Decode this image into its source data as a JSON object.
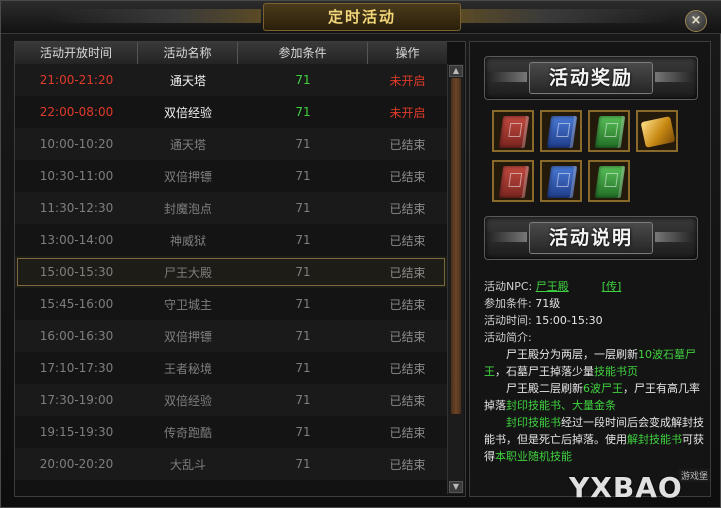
{
  "window": {
    "title": "定时活动",
    "close_glyph": "×"
  },
  "table": {
    "headers": [
      "活动开放时间",
      "活动名称",
      "参加条件",
      "操作"
    ],
    "rows": [
      {
        "time": "21:00-21:20",
        "name": "通天塔",
        "condition": "71",
        "action": "未开启",
        "state": "active"
      },
      {
        "time": "22:00-08:00",
        "name": "双倍经验",
        "condition": "71",
        "action": "未开启",
        "state": "active"
      },
      {
        "time": "10:00-10:20",
        "name": "通天塔",
        "condition": "71",
        "action": "已结束",
        "state": "ended"
      },
      {
        "time": "10:30-11:00",
        "name": "双倍押镖",
        "condition": "71",
        "action": "已结束",
        "state": "ended"
      },
      {
        "time": "11:30-12:30",
        "name": "封魔泡点",
        "condition": "71",
        "action": "已结束",
        "state": "ended"
      },
      {
        "time": "13:00-14:00",
        "name": "神威狱",
        "condition": "71",
        "action": "已结束",
        "state": "ended"
      },
      {
        "time": "15:00-15:30",
        "name": "尸王大殿",
        "condition": "71",
        "action": "已结束",
        "state": "ended",
        "selected": true
      },
      {
        "time": "15:45-16:00",
        "name": "守卫城主",
        "condition": "71",
        "action": "已结束",
        "state": "ended"
      },
      {
        "time": "16:00-16:30",
        "name": "双倍押镖",
        "condition": "71",
        "action": "已结束",
        "state": "ended"
      },
      {
        "time": "17:10-17:30",
        "name": "王者秘境",
        "condition": "71",
        "action": "已结束",
        "state": "ended"
      },
      {
        "time": "17:30-19:00",
        "name": "双倍经验",
        "condition": "71",
        "action": "已结束",
        "state": "ended"
      },
      {
        "time": "19:15-19:30",
        "name": "传奇跑酷",
        "condition": "71",
        "action": "已结束",
        "state": "ended"
      },
      {
        "time": "20:00-20:20",
        "name": "大乱斗",
        "condition": "71",
        "action": "已结束",
        "state": "ended"
      }
    ]
  },
  "rewards": {
    "banner": "活动奖励",
    "items": [
      {
        "icon": "red-skill-book-icon",
        "color": "red"
      },
      {
        "icon": "blue-skill-book-icon",
        "color": "blue"
      },
      {
        "icon": "green-skill-book-icon",
        "color": "green"
      },
      {
        "icon": "gold-ingot-icon",
        "color": "gold"
      },
      {
        "icon": "red-skill-book-icon",
        "color": "red"
      },
      {
        "icon": "blue-skill-book-icon",
        "color": "blue"
      },
      {
        "icon": "green-skill-book-icon",
        "color": "green"
      }
    ]
  },
  "description": {
    "banner": "活动说明",
    "npc_label": "活动NPC:",
    "npc_name": "尸王殿",
    "npc_link": "[传]",
    "condition_label": "参加条件:",
    "condition_value": "71级",
    "time_label": "活动时间:",
    "time_value": "15:00-15:30",
    "intro_label": "活动简介:",
    "p1_a": "尸王殿分为两层，一层刷新",
    "p1_g1": "10波石墓",
    "p1_g2": "尸王",
    "p1_b": "，石墓尸王掉落少量",
    "p1_g3": "技能书页",
    "p2_a": "尸王殿二层刷新",
    "p2_g1": "6波尸王",
    "p2_b": "，尸王有高几率掉落",
    "p2_g2": "封印技能书、大量金条",
    "p3_g1": "封印技能书",
    "p3_a": "经过一段时间后会变成解封技能书，但是死亡后掉落。使用",
    "p3_g2": "解封技能书",
    "p3_b": "可获得",
    "p3_g3": "本职业随机技能"
  },
  "watermark": {
    "text": "YXBAO",
    "tag": "游戏堡"
  },
  "colors": {
    "active_red": "#e03a2a",
    "green": "#3fd23f",
    "gold_border": "#8a6a2a",
    "title_gold": "#f3d67a"
  }
}
